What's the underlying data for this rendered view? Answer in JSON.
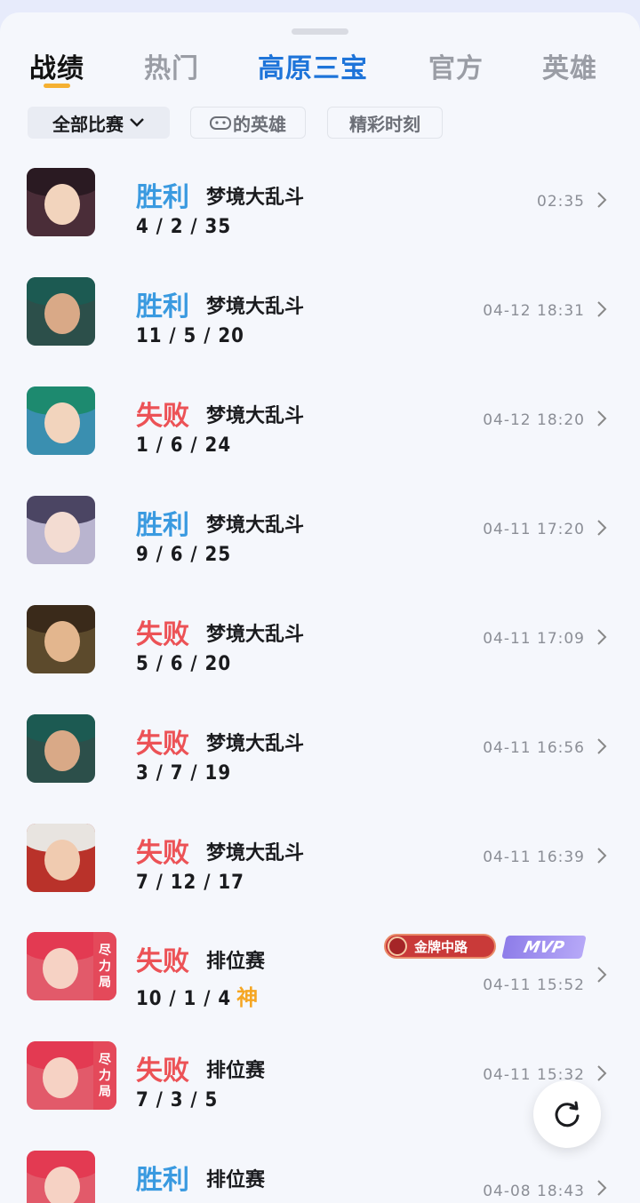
{
  "tabs": [
    {
      "label": "战绩"
    },
    {
      "label": "热门"
    },
    {
      "label": "高原三宝"
    },
    {
      "label": "官方"
    },
    {
      "label": "英雄"
    }
  ],
  "filters": {
    "all_matches": "全部比赛",
    "heroes": "的英雄",
    "highlights": "精彩时刻"
  },
  "matches": [
    {
      "result": "胜利",
      "mode": "梦境大乱斗",
      "kda": "4 / 2 / 35",
      "time": "02:35"
    },
    {
      "result": "胜利",
      "mode": "梦境大乱斗",
      "kda": "11 / 5 / 20",
      "time": "04-12 18:31"
    },
    {
      "result": "失败",
      "mode": "梦境大乱斗",
      "kda": "1 / 6 / 24",
      "time": "04-12 18:20"
    },
    {
      "result": "胜利",
      "mode": "梦境大乱斗",
      "kda": "9 / 6 / 25",
      "time": "04-11 17:20"
    },
    {
      "result": "失败",
      "mode": "梦境大乱斗",
      "kda": "5 / 6 / 20",
      "time": "04-11 17:09"
    },
    {
      "result": "失败",
      "mode": "梦境大乱斗",
      "kda": "3 / 7 / 19",
      "time": "04-11 16:56"
    },
    {
      "result": "失败",
      "mode": "梦境大乱斗",
      "kda": "7 / 12 / 17",
      "time": "04-11 16:39"
    },
    {
      "result": "失败",
      "mode": "排位赛",
      "kda": "10 / 1 / 4",
      "extra": "神",
      "time": "04-11 15:52",
      "honor": "金牌中路",
      "mvp": "MVP",
      "tag": [
        "尽",
        "力",
        "局"
      ]
    },
    {
      "result": "失败",
      "mode": "排位赛",
      "kda": "7 / 3 / 5",
      "time": "04-11 15:32",
      "tag": [
        "尽",
        "力",
        "局"
      ]
    },
    {
      "result": "胜利",
      "mode": "排位赛",
      "kda": "",
      "time": "04-08 18:43"
    }
  ],
  "colors": {
    "win": "#3a9ae0",
    "loss": "#ec5256",
    "accent": "#f5b032",
    "featured_tab": "#1e74d9"
  },
  "icons": {
    "filter_toggle": "chevron-down-icon",
    "row_open": "chevron-right-icon",
    "refresh": "refresh-icon",
    "game_controller": "gamepad-icon"
  }
}
